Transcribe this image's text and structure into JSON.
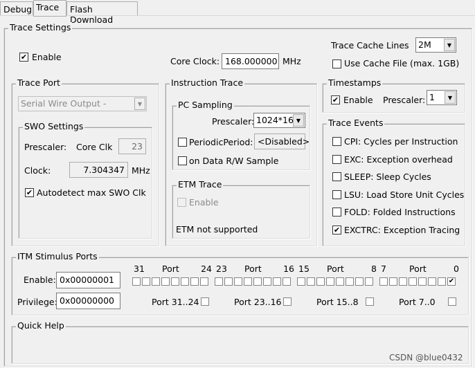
{
  "tabs": [
    {
      "label": "Debug"
    },
    {
      "label": "Trace"
    },
    {
      "label": "Flash Download"
    }
  ],
  "trace_settings": {
    "title": "Trace Settings",
    "enable_label": "Enable",
    "enable_checked": true,
    "core_clock_label": "Core Clock:",
    "core_clock_value": "168.000000",
    "core_clock_unit": "MHz",
    "cache_lines_label": "Trace Cache Lines",
    "cache_lines_value": "2M",
    "use_cache_label": "Use Cache File (max. 1GB)",
    "use_cache_checked": false
  },
  "trace_port": {
    "title": "Trace Port",
    "port_value": "Serial Wire Output - UART/NRZ",
    "swo": {
      "title": "SWO Settings",
      "prescaler_label": "Prescaler:",
      "core_clk_label": "Core Clk",
      "prescaler_value": "23",
      "clock_label": "Clock:",
      "clock_value": "7.304347",
      "clock_unit": "MHz",
      "autodetect_label": "Autodetect max SWO Clk",
      "autodetect_checked": true
    }
  },
  "instruction_trace": {
    "title": "Instruction Trace",
    "pc": {
      "title": "PC Sampling",
      "prescaler_label": "Prescaler:",
      "prescaler_value": "1024*16",
      "periodic_label": "PeriodicPeriod:",
      "periodic_value": "<Disabled>",
      "periodic_checked": false,
      "data_rw_label": "on Data R/W Sample",
      "data_rw_checked": false
    },
    "etm": {
      "title": "ETM Trace",
      "enable_label": "Enable",
      "status": "ETM not supported"
    }
  },
  "timestamps": {
    "title": "Timestamps",
    "enable_label": "Enable",
    "enable_checked": true,
    "prescaler_label": "Prescaler:",
    "prescaler_value": "1"
  },
  "trace_events": {
    "title": "Trace Events",
    "items": [
      {
        "label": "CPI: Cycles per Instruction",
        "checked": false
      },
      {
        "label": "EXC: Exception overhead",
        "checked": false
      },
      {
        "label": "SLEEP: Sleep Cycles",
        "checked": false
      },
      {
        "label": "LSU: Load Store Unit Cycles",
        "checked": false
      },
      {
        "label": "FOLD: Folded Instructions",
        "checked": false
      },
      {
        "label": "EXCTRC: Exception Tracing",
        "checked": true
      }
    ]
  },
  "itm": {
    "title": "ITM Stimulus Ports",
    "enable_label": "Enable:",
    "enable_value": "0x00000001",
    "privilege_label": "Privilege:",
    "privilege_value": "0x00000000",
    "groups": [
      {
        "hi": "31",
        "lo": "24",
        "port": "Port",
        "priv_label": "Port 31..24"
      },
      {
        "hi": "23",
        "lo": "16",
        "port": "Port",
        "priv_label": "Port 23..16"
      },
      {
        "hi": "15",
        "lo": "8",
        "port": "Port",
        "priv_label": "Port 15..8"
      },
      {
        "hi": "7",
        "lo": "0",
        "port": "Port",
        "priv_label": "Port 7..0"
      }
    ],
    "enabled_bits": [
      0
    ]
  },
  "quick_help": {
    "title": "Quick Help"
  },
  "watermark": "CSDN @blue0432"
}
